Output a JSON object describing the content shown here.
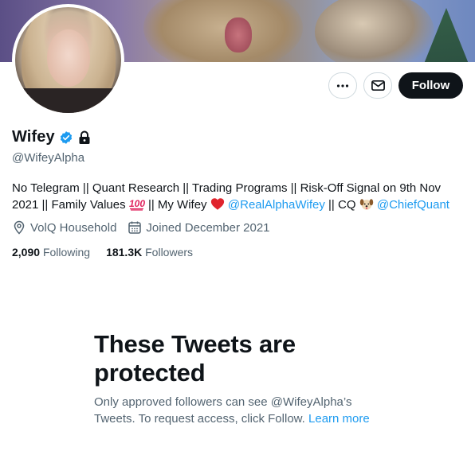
{
  "profile": {
    "name": "Wifey",
    "handle": "@WifeyAlpha",
    "bio": {
      "line1": "No Telegram || Quant Research || Trading Programs || Risk-Off Signal on 9th Nov",
      "line2_a": "2021 || Family Values",
      "line2_b": "|| My Wifey",
      "mention1": "@RealAlphaWifey",
      "line2_c": "|| CQ",
      "mention2": "@ChiefQuant"
    },
    "location": "VolQ Household",
    "joined": "Joined December 2021",
    "following_count": "2,090",
    "following_label": "Following",
    "followers_count": "181.3K",
    "followers_label": "Followers"
  },
  "actions": {
    "follow_label": "Follow"
  },
  "icons": {
    "more": "more-icon",
    "message": "envelope-icon",
    "verified": "verified-badge-icon",
    "lock": "lock-icon",
    "location": "location-pin-icon",
    "calendar": "calendar-icon",
    "hundred": "hundred-points-emoji",
    "heart": "red-heart-emoji",
    "dog": "dog-face-emoji"
  },
  "protected": {
    "title": "These Tweets are protected",
    "desc_line1": "Only approved followers can see @WifeyAlpha’s",
    "desc_line2": "Tweets. To request access, click Follow.",
    "learn_more": "Learn more"
  },
  "colors": {
    "accent": "#1d9bf0",
    "text": "#0f1419",
    "secondary": "#536471",
    "follow_bg": "#0f1419"
  }
}
